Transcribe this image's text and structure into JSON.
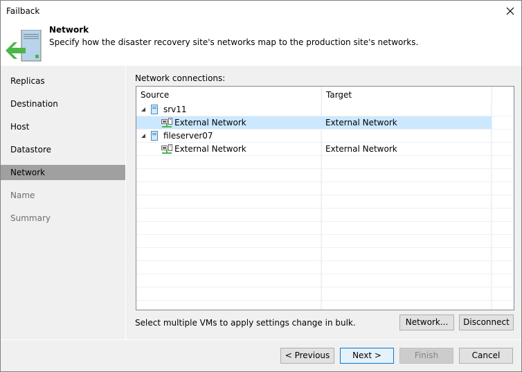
{
  "window": {
    "title": "Failback",
    "close_icon": "close-x"
  },
  "header": {
    "icon": "server-failback-arrow-icon",
    "title": "Network",
    "description": "Specify how the disaster recovery site's networks map to the production site's networks."
  },
  "sidebar": {
    "items": [
      {
        "label": "Replicas",
        "state": "normal"
      },
      {
        "label": "Destination",
        "state": "normal"
      },
      {
        "label": "Host",
        "state": "normal"
      },
      {
        "label": "Datastore",
        "state": "normal"
      },
      {
        "label": "Network",
        "state": "active"
      },
      {
        "label": "Name",
        "state": "disabled"
      },
      {
        "label": "Summary",
        "state": "disabled"
      }
    ]
  },
  "main": {
    "section_label": "Network connections:",
    "columns": [
      "Source",
      "Target"
    ],
    "rows": [
      {
        "type": "vm",
        "source": "srv11",
        "target": "",
        "expanded": true,
        "selected": false
      },
      {
        "type": "network",
        "source": "External Network",
        "target": "External Network",
        "selected": true
      },
      {
        "type": "vm",
        "source": "fileserver07",
        "target": "",
        "expanded": true,
        "selected": false
      },
      {
        "type": "network",
        "source": "External Network",
        "target": "External Network",
        "selected": false
      }
    ],
    "hint": "Select multiple VMs to apply settings change in bulk.",
    "network_button": "Network...",
    "disconnect_button": "Disconnect"
  },
  "footer": {
    "previous": "< Previous",
    "next": "Next >",
    "finish": "Finish",
    "cancel": "Cancel"
  },
  "colors": {
    "selected_row": "#cce8ff",
    "active_sidebar": "#a0a0a0",
    "primary_button_border": "#0078d7",
    "accent_green": "#4cb648"
  }
}
